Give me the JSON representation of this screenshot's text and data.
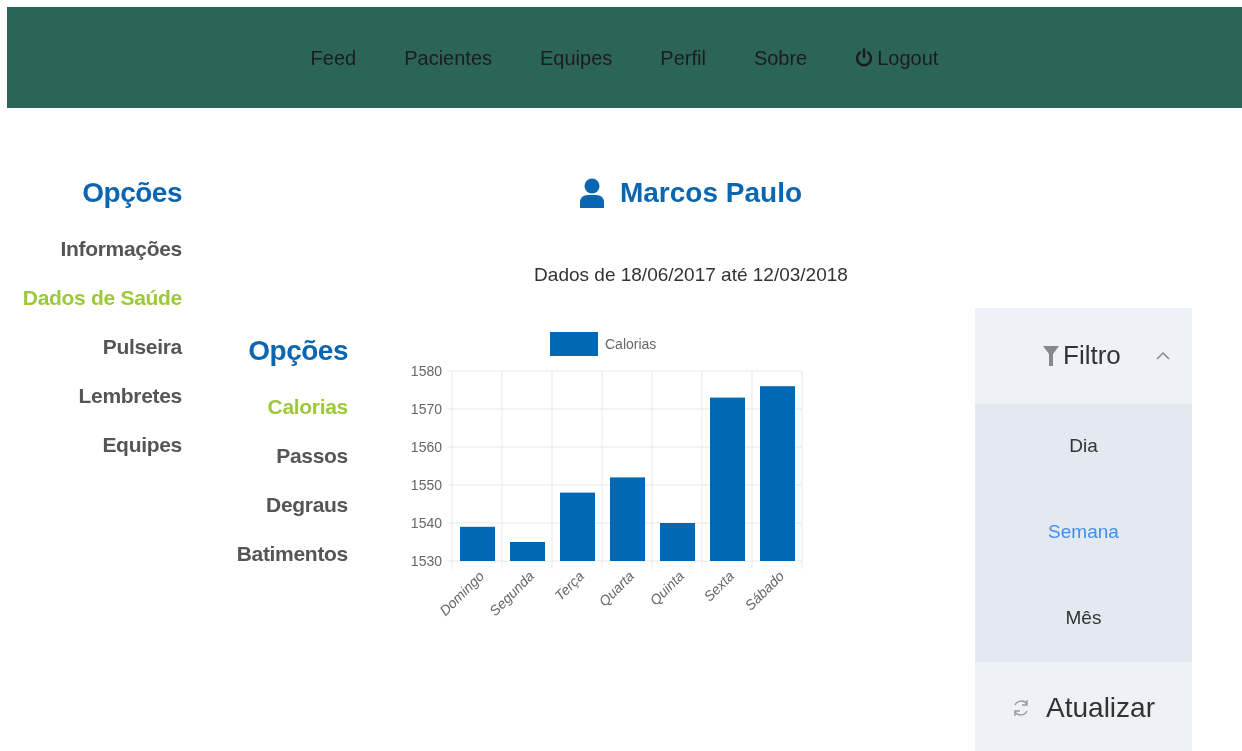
{
  "navbar": {
    "items": [
      {
        "label": "Feed",
        "kind": "link"
      },
      {
        "label": "Pacientes",
        "kind": "link"
      },
      {
        "label": "Equipes",
        "kind": "link"
      },
      {
        "label": "Perfil",
        "kind": "link"
      },
      {
        "label": "Sobre",
        "kind": "link"
      },
      {
        "label": "Logout",
        "kind": "logout"
      }
    ]
  },
  "sidebar": {
    "title": "Opções",
    "items": [
      {
        "label": "Informações",
        "selected": false
      },
      {
        "label": "Dados de Saúde",
        "selected": true
      },
      {
        "label": "Pulseira",
        "selected": false
      },
      {
        "label": "Lembretes",
        "selected": false
      },
      {
        "label": "Equipes",
        "selected": false
      }
    ]
  },
  "patient": {
    "name": "Marcos Paulo"
  },
  "date_range": "Dados de 18/06/2017 até 12/03/2018",
  "metrics": {
    "title": "Opções",
    "items": [
      {
        "label": "Calorias",
        "selected": true
      },
      {
        "label": "Passos",
        "selected": false
      },
      {
        "label": "Degraus",
        "selected": false
      },
      {
        "label": "Batimentos",
        "selected": false
      }
    ]
  },
  "chart": {
    "chart_data": {
      "type": "bar",
      "categories": [
        "Domingo",
        "Segunda",
        "Terça",
        "Quarta",
        "Quinta",
        "Sexta",
        "Sábado"
      ],
      "series": [
        {
          "name": "Calorias",
          "color": "#0068b5",
          "values": [
            1539,
            1535,
            1548,
            1552,
            1540,
            1573,
            1576
          ]
        }
      ],
      "grid": true,
      "ylim": [
        1530,
        1580
      ],
      "yticks": [
        1530,
        1540,
        1550,
        1560,
        1570,
        1580
      ]
    }
  },
  "filter": {
    "title": "Filtro",
    "expanded": true,
    "options": [
      {
        "label": "Dia",
        "selected": false
      },
      {
        "label": "Semana",
        "selected": true
      },
      {
        "label": "Mês",
        "selected": false
      }
    ],
    "refresh": "Atualizar"
  }
}
